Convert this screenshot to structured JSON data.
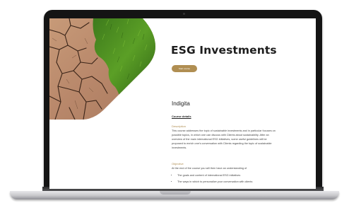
{
  "page": {
    "title": "ESG Investments",
    "start_button_label": "Start course",
    "organization": "Indigita",
    "course_details_heading": "Course details",
    "description": {
      "heading": "Description",
      "text": "This course addresses the topic of sustainable investments and in particular focuses on possible topics, in which one can discuss with Clients about sustainability. After an overview of the main international ESG initiatives, some useful guidelines will be proposed to enrich one's conversation with Clients regarding the topic of sustainable investments."
    },
    "objective": {
      "heading": "Objective",
      "intro": "At the end of the course you will then have an understanding of",
      "bullets": [
        "The goals and content of international ESG initiatives",
        "The ways in which to personalize your conversation with clients"
      ]
    }
  },
  "colors": {
    "accent": "#b08e52",
    "title": "#1d1d1d",
    "laptop_bezel": "#141414"
  },
  "icons": {
    "hero": "cracked-soil-and-grass-image"
  }
}
